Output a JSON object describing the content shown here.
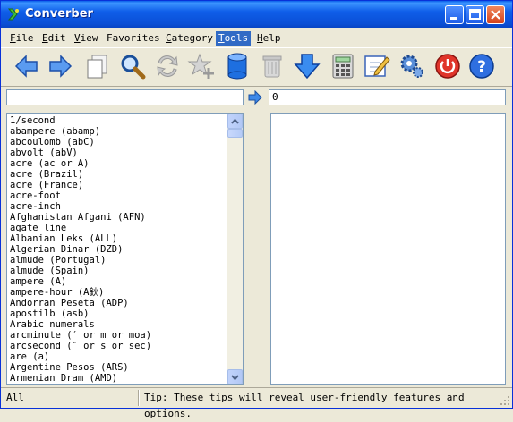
{
  "window": {
    "title": "Converber"
  },
  "menu": [
    {
      "label": "File",
      "underline": "F",
      "rest": "ile"
    },
    {
      "label": "Edit",
      "underline": "E",
      "rest": "dit"
    },
    {
      "label": "View",
      "underline": "V",
      "rest": "iew"
    },
    {
      "label": "Favorites",
      "underline": "",
      "rest": "Favorites"
    },
    {
      "label": "Category",
      "underline": "C",
      "rest": "ategory"
    },
    {
      "label": "Tools",
      "underline": "T",
      "rest": "ools"
    },
    {
      "label": "Help",
      "underline": "H",
      "rest": "elp"
    }
  ],
  "toolbar": {
    "icons": [
      "back-arrow-icon",
      "forward-arrow-icon",
      "copy-icon",
      "find-icon",
      "swap-icon",
      "add-favorite-icon",
      "database-icon",
      "trash-icon",
      "download-icon",
      "calculator-icon",
      "edit-icon",
      "settings-icon",
      "exit-icon",
      "help-icon"
    ]
  },
  "input": {
    "from_value": "",
    "to_value": "0"
  },
  "units": [
    "1/second",
    "abampere (abamp)",
    "abcoulomb (abC)",
    "abvolt (abV)",
    "acre (ac or A)",
    "acre (Brazil)",
    "acre (France)",
    "acre-foot",
    "acre-inch",
    "Afghanistan Afgani (AFN)",
    "agate line",
    "Albanian Leks (ALL)",
    "Algerian Dinar (DZD)",
    "almude (Portugal)",
    "almude (Spain)",
    "ampere (A)",
    "ampere-hour (A鈥)",
    "Andorran Peseta (ADP)",
    "apostilb (asb)",
    "Arabic numerals",
    "arcminute (′ or m or moa)",
    "arcsecond (″ or s or sec)",
    "are (a)",
    "Argentine Pesos (ARS)",
    "Armenian Dram (AMD)"
  ],
  "status": {
    "category": "All",
    "tip": "Tip: These tips will reveal user-friendly features and options."
  },
  "colors": {
    "title_bar": "#0a4fd6",
    "menu_active": "#316ac5",
    "field_border": "#7f9db9"
  }
}
